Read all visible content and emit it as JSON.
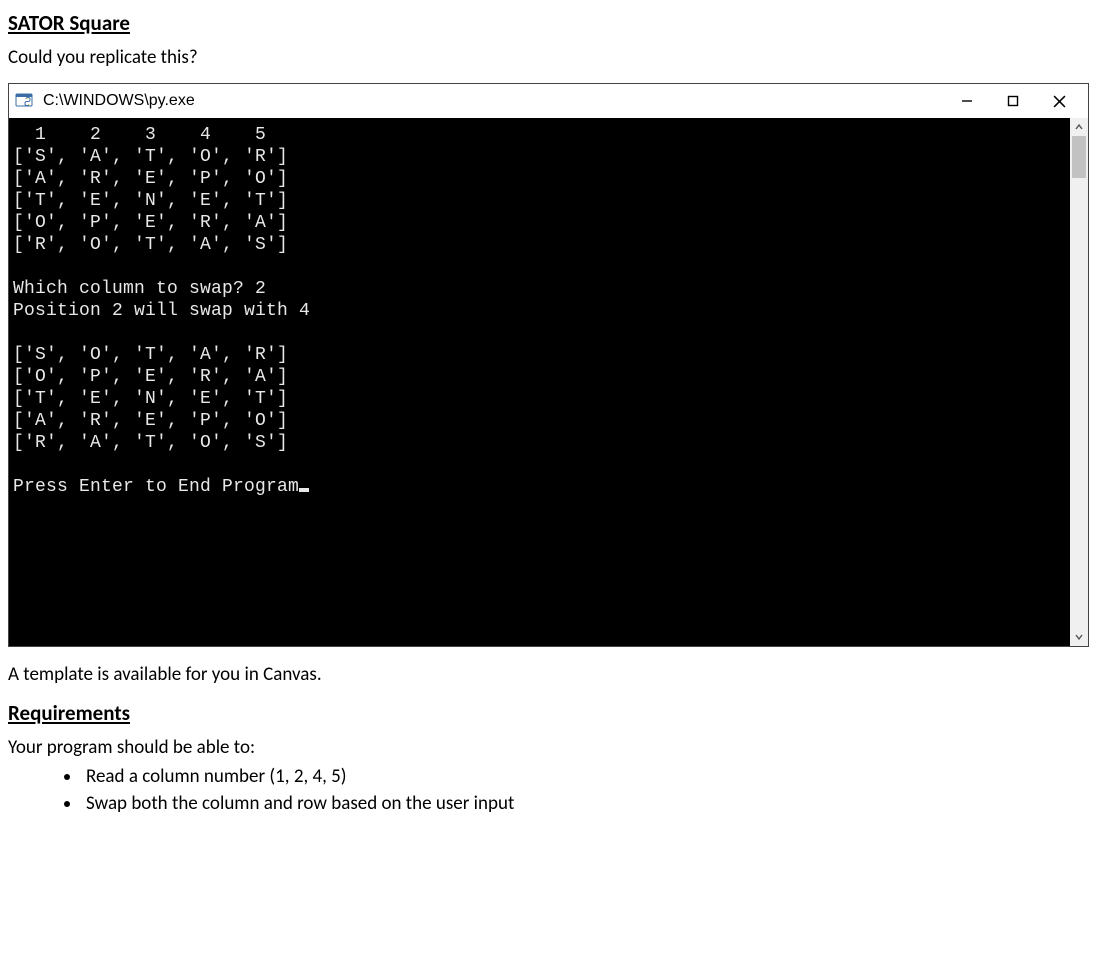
{
  "headings": {
    "title": "SATOR Square",
    "requirements": "Requirements"
  },
  "paragraphs": {
    "intro": "Could you replicate this?",
    "template_note": "A template is available for you in Canvas.",
    "req_intro": "Your program should be able to:"
  },
  "requirements_list": [
    "Read a column number (1, 2, 4, 5)",
    "Swap both the column and row based on the user input"
  ],
  "console": {
    "title": "C:\\WINDOWS\\py.exe",
    "lines": [
      "  1    2    3    4    5",
      "['S', 'A', 'T', 'O', 'R']",
      "['A', 'R', 'E', 'P', 'O']",
      "['T', 'E', 'N', 'E', 'T']",
      "['O', 'P', 'E', 'R', 'A']",
      "['R', 'O', 'T', 'A', 'S']",
      "",
      "Which column to swap? 2",
      "Position 2 will swap with 4",
      "",
      "['S', 'O', 'T', 'A', 'R']",
      "['O', 'P', 'E', 'R', 'A']",
      "['T', 'E', 'N', 'E', 'T']",
      "['A', 'R', 'E', 'P', 'O']",
      "['R', 'A', 'T', 'O', 'S']",
      "",
      "Press Enter to End Program"
    ],
    "input_column": "2",
    "swap_with": "4"
  }
}
